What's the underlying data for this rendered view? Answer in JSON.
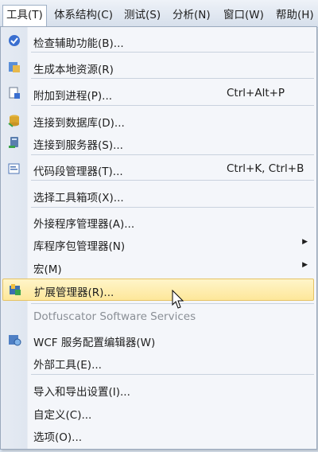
{
  "menubar": {
    "items": [
      "工具(T)",
      "体系结构(C)",
      "测试(S)",
      "分析(N)",
      "窗口(W)",
      "帮助(H)"
    ]
  },
  "menu": {
    "items": [
      {
        "label": "检查辅助功能(B)...",
        "icon": "accessibility-check-icon"
      },
      {
        "label": "生成本地资源(R)",
        "icon": "generate-resources-icon"
      },
      {
        "label": "附加到进程(P)...",
        "shortcut": "Ctrl+Alt+P",
        "icon": "attach-process-icon"
      },
      {
        "label": "连接到数据库(D)...",
        "icon": "connect-database-icon"
      },
      {
        "label": "连接到服务器(S)...",
        "icon": "connect-server-icon"
      },
      {
        "label": "代码段管理器(T)...",
        "shortcut": "Ctrl+K, Ctrl+B",
        "icon": "snippet-manager-icon"
      },
      {
        "label": "选择工具箱项(X)..."
      },
      {
        "label": "外接程序管理器(A)..."
      },
      {
        "label": "库程序包管理器(N)",
        "submenu": true
      },
      {
        "label": "宏(M)",
        "submenu": true
      },
      {
        "label": "扩展管理器(R)...",
        "icon": "extension-manager-icon",
        "highlighted": true
      },
      {
        "label": "Dotfuscator Software Services",
        "disabled": true
      },
      {
        "label": "WCF 服务配置编辑器(W)",
        "icon": "wcf-config-icon"
      },
      {
        "label": "外部工具(E)..."
      },
      {
        "label": "导入和导出设置(I)..."
      },
      {
        "label": "自定义(C)..."
      },
      {
        "label": "选项(O)..."
      }
    ]
  },
  "colors": {
    "highlight": "#fde79a",
    "menu_background": "#f4f6fa",
    "disabled_text": "#8a8f96"
  }
}
